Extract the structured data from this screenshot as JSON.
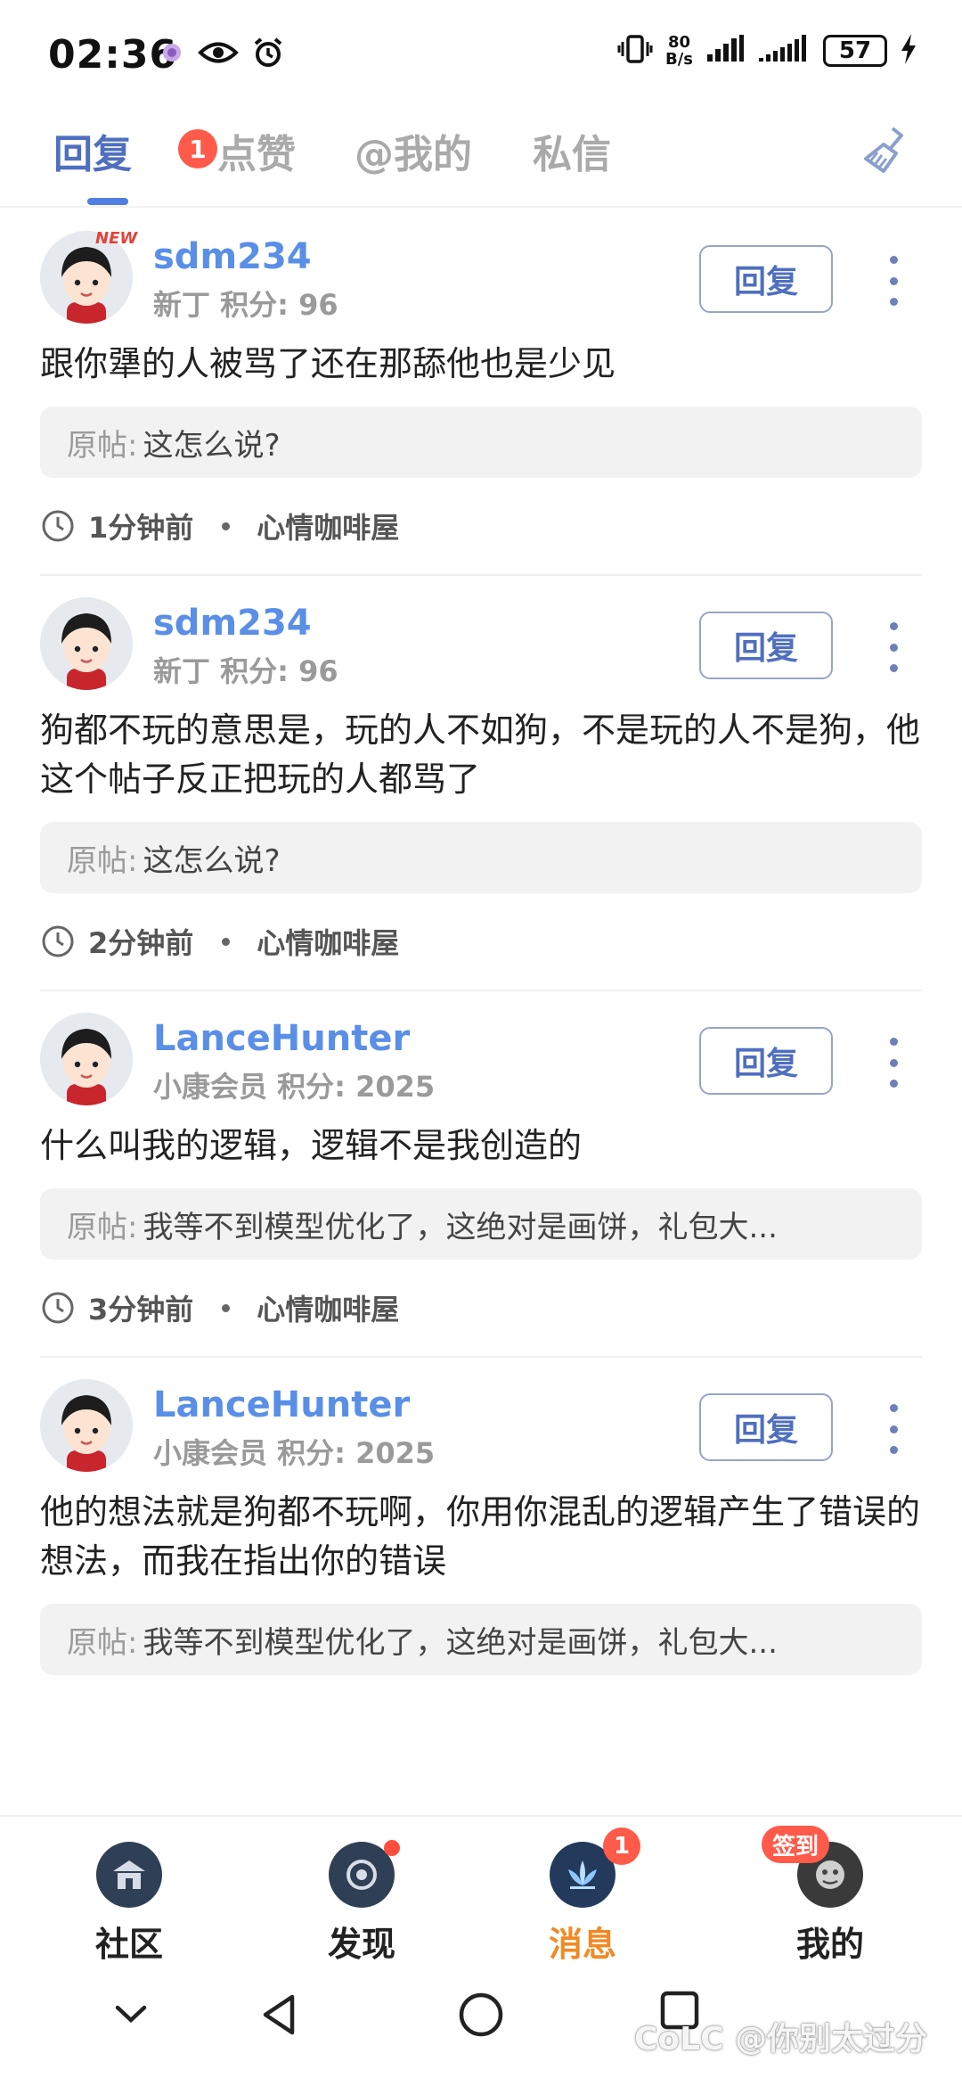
{
  "status_bar": {
    "time": "02:36",
    "net_speed_value": "80",
    "net_speed_unit": "B/s",
    "battery": "57"
  },
  "tabs": [
    {
      "label": "回复",
      "badge": "1",
      "active": true
    },
    {
      "label": "点赞",
      "active": false
    },
    {
      "label": "@我的",
      "active": false
    },
    {
      "label": "私信",
      "active": false
    }
  ],
  "posts": [
    {
      "username": "sdm234",
      "new_tag": "NEW",
      "meta": "新丁  积分: 96",
      "reply_label": "回复",
      "content": "跟你犟的人被骂了还在那舔他也是少见",
      "quote_label": "原帖:",
      "quote_text": "这怎么说?",
      "time": "1分钟前",
      "board": "心情咖啡屋"
    },
    {
      "username": "sdm234",
      "meta": "新丁  积分: 96",
      "reply_label": "回复",
      "content": "狗都不玩的意思是，玩的人不如狗，不是玩的人不是狗，他这个帖子反正把玩的人都骂了",
      "quote_label": "原帖:",
      "quote_text": "这怎么说?",
      "time": "2分钟前",
      "board": "心情咖啡屋"
    },
    {
      "username": "LanceHunter",
      "meta": "小康会员  积分: 2025",
      "reply_label": "回复",
      "content": "什么叫我的逻辑，逻辑不是我创造的",
      "quote_label": "原帖:",
      "quote_text": "我等不到模型优化了，这绝对是画饼，礼包大...",
      "time": "3分钟前",
      "board": "心情咖啡屋"
    },
    {
      "username": "LanceHunter",
      "meta": "小康会员  积分: 2025",
      "reply_label": "回复",
      "content": "他的想法就是狗都不玩啊，你用你混乱的逻辑产生了错误的想法，而我在指出你的错误",
      "quote_label": "原帖:",
      "quote_text": "我等不到模型优化了，这绝对是画饼，礼包大..."
    }
  ],
  "bottom_nav": [
    {
      "label": "社区",
      "icon": "community-icon"
    },
    {
      "label": "发现",
      "icon": "discover-icon",
      "dot": true
    },
    {
      "label": "消息",
      "icon": "message-icon",
      "badge": "1",
      "active": true
    },
    {
      "label": "我的",
      "icon": "profile-icon",
      "signin": "签到"
    }
  ],
  "watermark": "CoLC @你别太过分",
  "colors": {
    "accent": "#4f6fbf",
    "username": "#5a8fe8",
    "badge": "#ff5a4a",
    "active_nav": "#f08a24"
  }
}
